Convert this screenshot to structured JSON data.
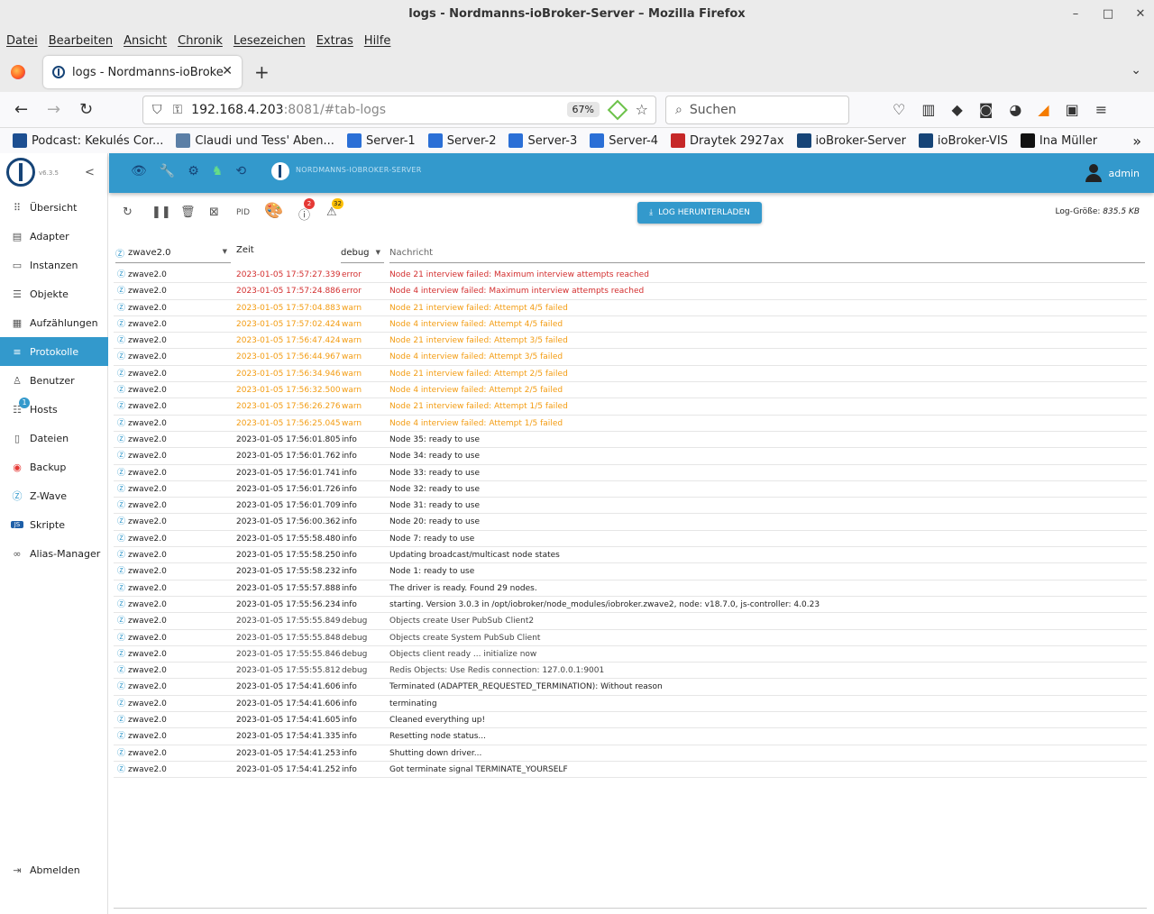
{
  "window": {
    "title": "logs - Nordmanns-ioBroker-Server – Mozilla Firefox"
  },
  "menu": [
    "Datei",
    "Bearbeiten",
    "Ansicht",
    "Chronik",
    "Lesezeichen",
    "Extras",
    "Hilfe"
  ],
  "tab": {
    "title": "logs - Nordmanns-ioBroker-Server"
  },
  "urlbar": {
    "host": "192.168.4.203",
    "rest": ":8081/#tab-logs",
    "zoom": "67%"
  },
  "search": {
    "placeholder": "Suchen"
  },
  "bookmarks": [
    {
      "label": "Podcast: Kekulés Cor...",
      "color": "#1d4f91"
    },
    {
      "label": "Claudi und Tess' Aben...",
      "color": "#5b7fa6"
    },
    {
      "label": "Server-1",
      "color": "#2a6fd6"
    },
    {
      "label": "Server-2",
      "color": "#2a6fd6"
    },
    {
      "label": "Server-3",
      "color": "#2a6fd6"
    },
    {
      "label": "Server-4",
      "color": "#2a6fd6"
    },
    {
      "label": "Draytek 2927ax",
      "color": "#c62828"
    },
    {
      "label": "ioBroker-Server",
      "color": "#164477"
    },
    {
      "label": "ioBroker-VIS",
      "color": "#164477"
    },
    {
      "label": "Ina Müller",
      "color": "#111111"
    }
  ],
  "sidebar": {
    "version": "v6.3.5",
    "items": [
      {
        "label": "Übersicht",
        "icon": "⠿"
      },
      {
        "label": "Adapter",
        "icon": "▤"
      },
      {
        "label": "Instanzen",
        "icon": "▭"
      },
      {
        "label": "Objekte",
        "icon": "☰"
      },
      {
        "label": "Aufzählungen",
        "icon": "▦"
      },
      {
        "label": "Protokolle",
        "icon": "≡"
      },
      {
        "label": "Benutzer",
        "icon": "♙"
      },
      {
        "label": "Hosts",
        "icon": "☷"
      },
      {
        "label": "Dateien",
        "icon": "▯"
      },
      {
        "label": "Backup",
        "icon": "◉"
      },
      {
        "label": "Z-Wave",
        "icon": "Ⓩ"
      },
      {
        "label": "Skripte",
        "icon": "JS"
      },
      {
        "label": "Alias-Manager",
        "icon": "∞"
      }
    ],
    "hosts_badge": "1",
    "logout": "Abmelden"
  },
  "appbar": {
    "server_title": "NORDMANNS-IOBROKER-SERVER",
    "user": "admin"
  },
  "toolbar": {
    "pid": "PID",
    "errors_count": "2",
    "warnings_count": "32",
    "download_label": "LOG HERUNTERLADEN",
    "log_size_label": "Log-Größe:",
    "log_size_value": "835.5 KB"
  },
  "table": {
    "source_filter": "zwave2.0",
    "time_header": "Zeit",
    "level_filter": "debug",
    "message_placeholder": "Nachricht"
  },
  "logs": [
    {
      "src": "zwave2.0",
      "time": "2023-01-05 17:57:27.339",
      "level": "error",
      "msg": "Node 21 interview failed: Maximum interview attempts reached"
    },
    {
      "src": "zwave2.0",
      "time": "2023-01-05 17:57:24.886",
      "level": "error",
      "msg": "Node 4 interview failed: Maximum interview attempts reached"
    },
    {
      "src": "zwave2.0",
      "time": "2023-01-05 17:57:04.883",
      "level": "warn",
      "msg": "Node 21 interview failed: Attempt 4/5 failed"
    },
    {
      "src": "zwave2.0",
      "time": "2023-01-05 17:57:02.424",
      "level": "warn",
      "msg": "Node 4 interview failed: Attempt 4/5 failed"
    },
    {
      "src": "zwave2.0",
      "time": "2023-01-05 17:56:47.424",
      "level": "warn",
      "msg": "Node 21 interview failed: Attempt 3/5 failed"
    },
    {
      "src": "zwave2.0",
      "time": "2023-01-05 17:56:44.967",
      "level": "warn",
      "msg": "Node 4 interview failed: Attempt 3/5 failed"
    },
    {
      "src": "zwave2.0",
      "time": "2023-01-05 17:56:34.946",
      "level": "warn",
      "msg": "Node 21 interview failed: Attempt 2/5 failed"
    },
    {
      "src": "zwave2.0",
      "time": "2023-01-05 17:56:32.500",
      "level": "warn",
      "msg": "Node 4 interview failed: Attempt 2/5 failed"
    },
    {
      "src": "zwave2.0",
      "time": "2023-01-05 17:56:26.276",
      "level": "warn",
      "msg": "Node 21 interview failed: Attempt 1/5 failed"
    },
    {
      "src": "zwave2.0",
      "time": "2023-01-05 17:56:25.045",
      "level": "warn",
      "msg": "Node 4 interview failed: Attempt 1/5 failed"
    },
    {
      "src": "zwave2.0",
      "time": "2023-01-05 17:56:01.805",
      "level": "info",
      "msg": "Node 35: ready to use"
    },
    {
      "src": "zwave2.0",
      "time": "2023-01-05 17:56:01.762",
      "level": "info",
      "msg": "Node 34: ready to use"
    },
    {
      "src": "zwave2.0",
      "time": "2023-01-05 17:56:01.741",
      "level": "info",
      "msg": "Node 33: ready to use"
    },
    {
      "src": "zwave2.0",
      "time": "2023-01-05 17:56:01.726",
      "level": "info",
      "msg": "Node 32: ready to use"
    },
    {
      "src": "zwave2.0",
      "time": "2023-01-05 17:56:01.709",
      "level": "info",
      "msg": "Node 31: ready to use"
    },
    {
      "src": "zwave2.0",
      "time": "2023-01-05 17:56:00.362",
      "level": "info",
      "msg": "Node 20: ready to use"
    },
    {
      "src": "zwave2.0",
      "time": "2023-01-05 17:55:58.480",
      "level": "info",
      "msg": "Node 7: ready to use"
    },
    {
      "src": "zwave2.0",
      "time": "2023-01-05 17:55:58.250",
      "level": "info",
      "msg": "Updating broadcast/multicast node states"
    },
    {
      "src": "zwave2.0",
      "time": "2023-01-05 17:55:58.232",
      "level": "info",
      "msg": "Node 1: ready to use"
    },
    {
      "src": "zwave2.0",
      "time": "2023-01-05 17:55:57.888",
      "level": "info",
      "msg": "The driver is ready. Found 29 nodes."
    },
    {
      "src": "zwave2.0",
      "time": "2023-01-05 17:55:56.234",
      "level": "info",
      "msg": "starting. Version 3.0.3 in /opt/iobroker/node_modules/iobroker.zwave2, node: v18.7.0, js-controller: 4.0.23"
    },
    {
      "src": "zwave2.0",
      "time": "2023-01-05 17:55:55.849",
      "level": "debug",
      "msg": "Objects create User PubSub Client2"
    },
    {
      "src": "zwave2.0",
      "time": "2023-01-05 17:55:55.848",
      "level": "debug",
      "msg": "Objects create System PubSub Client"
    },
    {
      "src": "zwave2.0",
      "time": "2023-01-05 17:55:55.846",
      "level": "debug",
      "msg": "Objects client ready ... initialize now"
    },
    {
      "src": "zwave2.0",
      "time": "2023-01-05 17:55:55.812",
      "level": "debug",
      "msg": "Redis Objects: Use Redis connection: 127.0.0.1:9001"
    },
    {
      "src": "zwave2.0",
      "time": "2023-01-05 17:54:41.606",
      "level": "info",
      "msg": "Terminated (ADAPTER_REQUESTED_TERMINATION): Without reason"
    },
    {
      "src": "zwave2.0",
      "time": "2023-01-05 17:54:41.606",
      "level": "info",
      "msg": "terminating"
    },
    {
      "src": "zwave2.0",
      "time": "2023-01-05 17:54:41.605",
      "level": "info",
      "msg": "Cleaned everything up!"
    },
    {
      "src": "zwave2.0",
      "time": "2023-01-05 17:54:41.335",
      "level": "info",
      "msg": "Resetting node status..."
    },
    {
      "src": "zwave2.0",
      "time": "2023-01-05 17:54:41.253",
      "level": "info",
      "msg": "Shutting down driver..."
    },
    {
      "src": "zwave2.0",
      "time": "2023-01-05 17:54:41.252",
      "level": "info",
      "msg": "Got terminate signal TERMINATE_YOURSELF"
    }
  ]
}
